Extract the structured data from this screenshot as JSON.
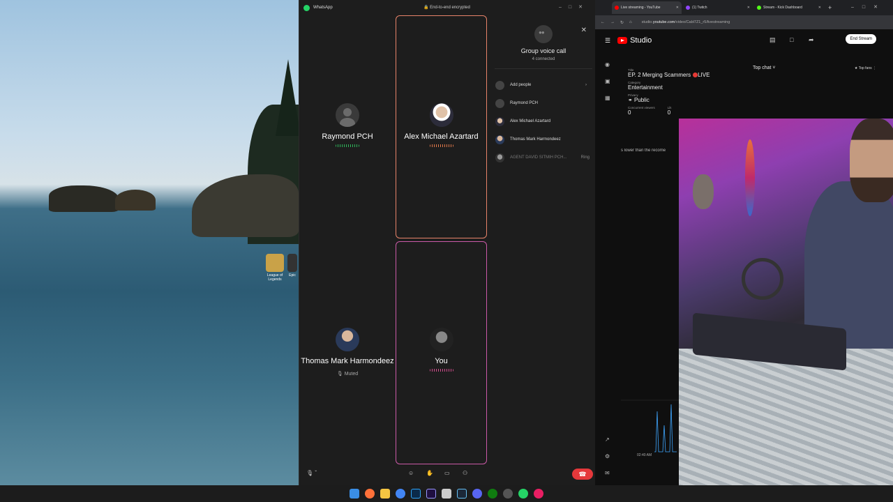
{
  "desktop": {
    "icons": [
      {
        "label": "League of Legends",
        "color": "#c9a248"
      },
      {
        "label": "Epic",
        "color": "#333333"
      }
    ]
  },
  "whatsapp": {
    "app_title": "WhatsApp",
    "encryption": "End-to-end encrypted",
    "tiles": [
      {
        "name": "Raymond PCH",
        "status": ""
      },
      {
        "name": "Alex Michael Azartard",
        "status": ""
      },
      {
        "name": "Thomas Mark Harmondeez",
        "status": "Muted"
      },
      {
        "name": "You",
        "status": ""
      }
    ],
    "panel": {
      "title": "Group voice call",
      "subtitle": "4 connected",
      "add_people": "Add people",
      "participants": [
        {
          "name": "Raymond PCH",
          "action": ""
        },
        {
          "name": "Alex Michael Azartard",
          "action": ""
        },
        {
          "name": "Thomas Mark Harmondeez",
          "action": ""
        },
        {
          "name": "AGENT DAVID SITMIH PCH...",
          "action": "Ring"
        }
      ]
    }
  },
  "browser": {
    "tabs": [
      {
        "label": "Live streaming - YouTube",
        "color": "#ff0000"
      },
      {
        "label": "(1) Twitch",
        "color": "#9146ff"
      },
      {
        "label": "Stream - Kick Dashboard",
        "color": "#53fc18"
      }
    ],
    "url_prefix": "studio.",
    "url_domain": "youtube.com",
    "url_rest": "/video/Cabl7Z1_r5/livestreaming",
    "studio": {
      "brand": "Studio",
      "end_stream": "End Stream",
      "title_label": "Title",
      "title": "EP. 2 Merging Scammers",
      "live_label": "LIVE",
      "category_label": "Category",
      "category": "Entertainment",
      "privacy_label": "Privacy",
      "privacy": "Public",
      "viewers_label": "Concurrent viewers",
      "viewers": "0",
      "likes_label": "Lik",
      "likes": "0",
      "warning": "s lower than the recome",
      "top_chat": "Top chat",
      "top_fans": "Top fans",
      "graph_time": "02:40 AM"
    }
  },
  "taskbar": {
    "apps": [
      "windows-start",
      "firefox",
      "file-explorer",
      "chrome",
      "photoshop",
      "premiere",
      "notepad",
      "steam",
      "discord",
      "xbox",
      "obs",
      "whatsapp",
      "media-player"
    ],
    "colors": [
      "#3a8ee6",
      "#ff7139",
      "#f5c542",
      "#4285f4",
      "#2fa3f7",
      "#9999ff",
      "#cccccc",
      "#1b2838",
      "#5865f2",
      "#107c10",
      "#555555",
      "#25d366",
      "#e91e63"
    ]
  }
}
